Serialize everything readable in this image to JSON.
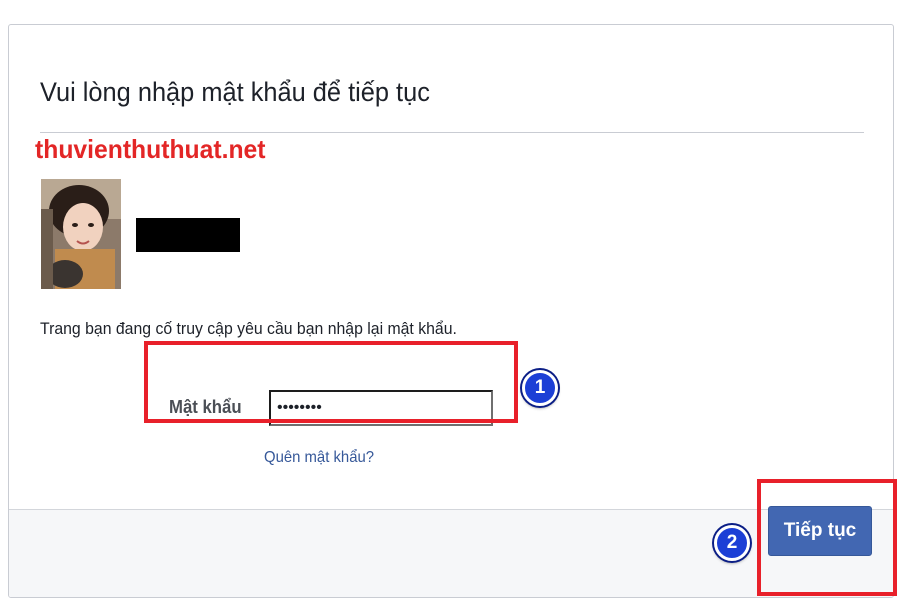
{
  "dialog": {
    "title": "Vui lòng nhập mật khẩu để tiếp tục",
    "watermark": "thuvienthuthuat.net",
    "message": "Trang bạn đang cố truy cập yêu cầu bạn nhập lại mật khẩu.",
    "password_label": "Mật khẩu",
    "password_value": "••••••••",
    "forgot_link": "Quên mật khẩu?",
    "continue_label": "Tiếp tục"
  },
  "annotations": {
    "step1": "1",
    "step2": "2",
    "highlight_color": "#e8202a",
    "badge_color": "#1c3fd6"
  },
  "colors": {
    "button_bg": "#4267b2",
    "link": "#365899",
    "watermark": "#e32626"
  }
}
